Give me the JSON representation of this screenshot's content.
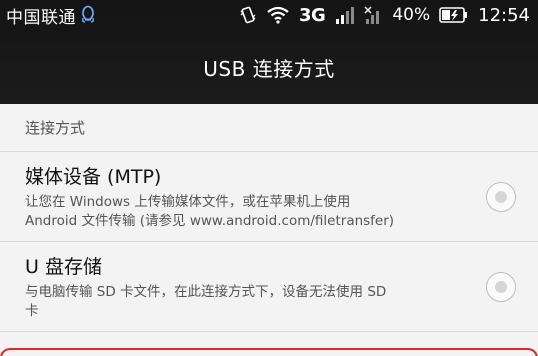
{
  "status_bar": {
    "carrier": "中国联通",
    "network": "3G",
    "battery_percent": "40%",
    "time": "12:54"
  },
  "app_bar": {
    "title": "USB 连接方式"
  },
  "section": {
    "header": "连接方式"
  },
  "options": [
    {
      "title": "媒体设备 (MTP)",
      "desc_line1": "让您在 Windows 上传输媒体文件，或在苹果机上使用",
      "desc_line2": "Android 文件传输 (请参见 www.android.com/filetransfer)",
      "selected": false
    },
    {
      "title": "U 盘存储",
      "desc_line1": "与电脑传输 SD 卡文件，在此连接方式下，设备无法使用 SD",
      "desc_line2": "卡",
      "selected": false
    }
  ],
  "colors": {
    "top_bar": "#141414",
    "background": "#f3f3f3",
    "highlight_border": "#e0262a"
  }
}
